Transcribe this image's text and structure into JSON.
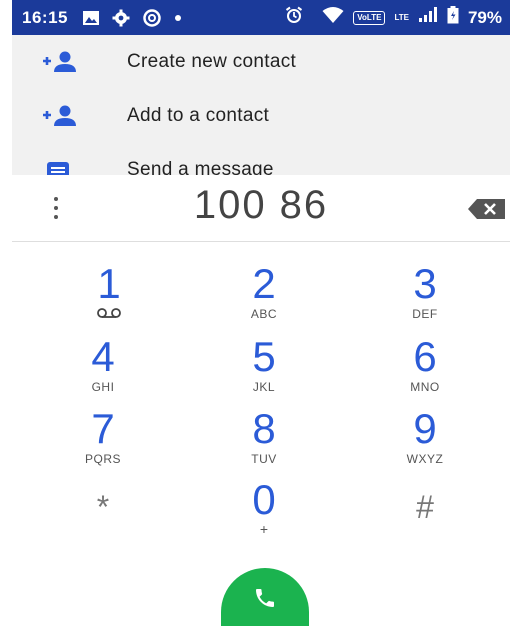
{
  "status_bar": {
    "time": "16:15",
    "volte": "VoLTE",
    "lte": "LTE",
    "battery": "79%",
    "icons": [
      "image-icon",
      "gear-icon",
      "data-saver-icon",
      "dot-icon",
      "alarm-icon",
      "wifi-icon",
      "volte-icon",
      "signal-icon",
      "battery-icon"
    ],
    "background": "#1b3a9a"
  },
  "suggestions": [
    {
      "label": "Create new contact",
      "icon": "add-person-icon"
    },
    {
      "label": "Add to a contact",
      "icon": "add-person-icon"
    },
    {
      "label": "Send a message",
      "icon": "message-icon"
    }
  ],
  "dialer": {
    "number": "100 86",
    "accent": "#2b5bd7",
    "call_color": "#1bb34f"
  },
  "keypad": [
    {
      "digit": "1",
      "letters": ""
    },
    {
      "digit": "2",
      "letters": "ABC"
    },
    {
      "digit": "3",
      "letters": "DEF"
    },
    {
      "digit": "4",
      "letters": "GHI"
    },
    {
      "digit": "5",
      "letters": "JKL"
    },
    {
      "digit": "6",
      "letters": "MNO"
    },
    {
      "digit": "7",
      "letters": "PQRS"
    },
    {
      "digit": "8",
      "letters": "TUV"
    },
    {
      "digit": "9",
      "letters": "WXYZ"
    },
    {
      "digit": "*",
      "letters": ""
    },
    {
      "digit": "0",
      "letters": "+"
    },
    {
      "digit": "#",
      "letters": ""
    }
  ]
}
